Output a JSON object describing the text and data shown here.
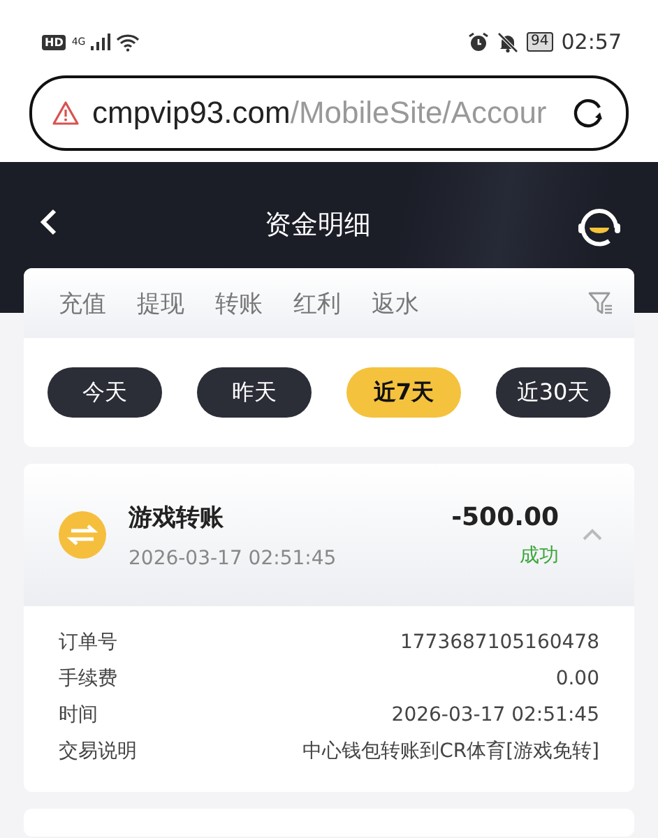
{
  "status_bar": {
    "hd": "HD",
    "network": "4G",
    "battery": "94",
    "time": "02:57"
  },
  "browser": {
    "domain": "cmpvip93.com",
    "path": "/MobileSite/Accour"
  },
  "header": {
    "title": "资金明细"
  },
  "tabs": [
    {
      "label": "充值",
      "selected": false
    },
    {
      "label": "提现",
      "selected": false
    },
    {
      "label": "转账",
      "selected": false
    },
    {
      "label": "红利",
      "selected": false
    },
    {
      "label": "返水",
      "selected": false
    }
  ],
  "date_filters": [
    {
      "label": "今天",
      "selected": false
    },
    {
      "label": "昨天",
      "selected": false
    },
    {
      "label": "近7天",
      "selected": true
    },
    {
      "label": "近30天",
      "selected": false
    }
  ],
  "transactions": [
    {
      "title": "游戏转账",
      "time": "2026-03-17 02:51:45",
      "amount": "-500.00",
      "status": "成功",
      "success": true,
      "expanded": true,
      "details": [
        {
          "label": "订单号",
          "value": "1773687105160478"
        },
        {
          "label": "手续费",
          "value": "0.00"
        },
        {
          "label": "时间",
          "value": "2026-03-17 02:51:45"
        },
        {
          "label": "交易说明",
          "value": "中心钱包转账到CR体育[游戏免转]"
        }
      ]
    }
  ]
}
